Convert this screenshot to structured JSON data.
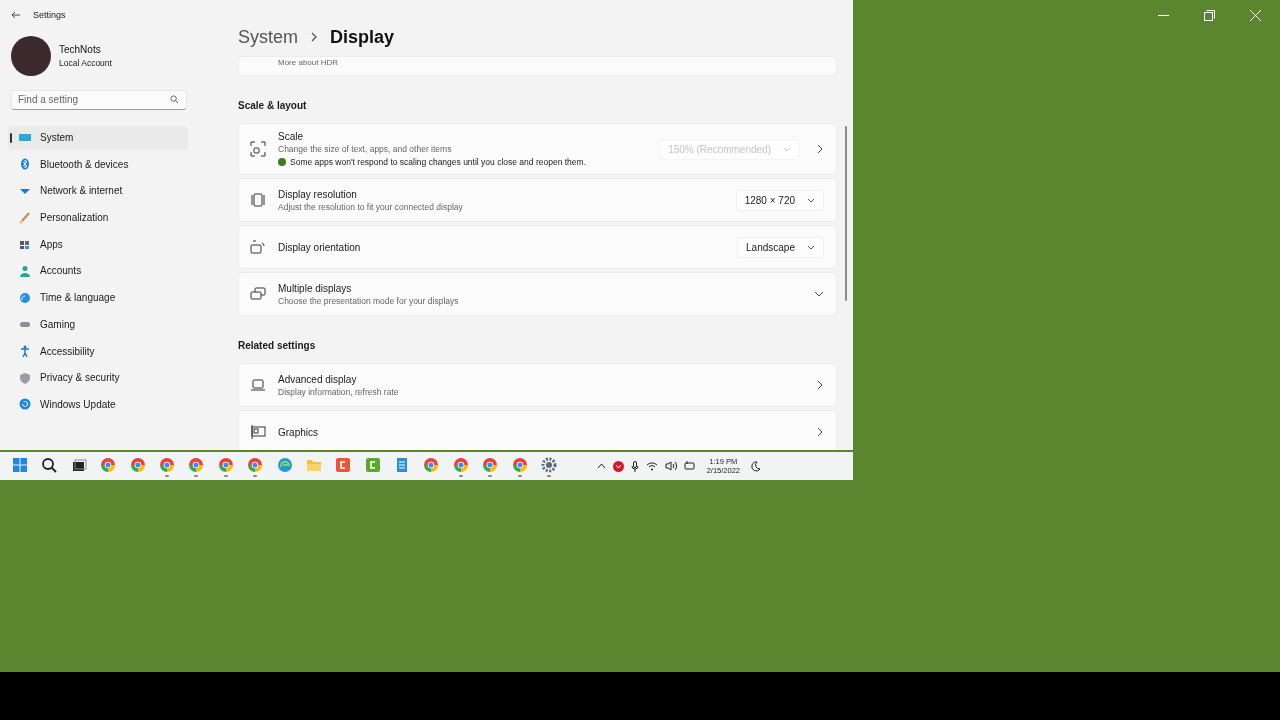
{
  "window": {
    "title": "Settings"
  },
  "account": {
    "name": "TechNots",
    "type": "Local Account"
  },
  "search": {
    "placeholder": "Find a setting"
  },
  "sidebar": {
    "items": [
      {
        "label": "System",
        "selected": true
      },
      {
        "label": "Bluetooth & devices",
        "selected": false
      },
      {
        "label": "Network & internet",
        "selected": false
      },
      {
        "label": "Personalization",
        "selected": false
      },
      {
        "label": "Apps",
        "selected": false
      },
      {
        "label": "Accounts",
        "selected": false
      },
      {
        "label": "Time & language",
        "selected": false
      },
      {
        "label": "Gaming",
        "selected": false
      },
      {
        "label": "Accessibility",
        "selected": false
      },
      {
        "label": "Privacy & security",
        "selected": false
      },
      {
        "label": "Windows Update",
        "selected": false
      }
    ]
  },
  "breadcrumb": {
    "parent": "System",
    "current": "Display"
  },
  "top_card": {
    "label": "More about HDR"
  },
  "sections": [
    {
      "heading": "Scale & layout",
      "rows": [
        {
          "kind": "dropdown-link",
          "title": "Scale",
          "description": "Change the size of text, apps, and other items",
          "note": "Some apps won't respond to scaling changes until you close and reopen them.",
          "value": "150% (Recommended)",
          "disabled": true
        },
        {
          "kind": "dropdown",
          "title": "Display resolution",
          "description": "Adjust the resolution to fit your connected display",
          "value": "1280 × 720",
          "disabled": false
        },
        {
          "kind": "dropdown",
          "title": "Display orientation",
          "value": "Landscape",
          "disabled": false
        },
        {
          "kind": "expander",
          "title": "Multiple displays",
          "description": "Choose the presentation mode for your displays",
          "expanded": false
        }
      ]
    },
    {
      "heading": "Related settings",
      "rows": [
        {
          "kind": "link",
          "title": "Advanced display",
          "description": "Display information, refresh rate"
        },
        {
          "kind": "link",
          "title": "Graphics"
        }
      ]
    }
  ],
  "taskbar": {
    "apps": [
      {
        "kind": "start"
      },
      {
        "kind": "search"
      },
      {
        "kind": "taskview"
      },
      {
        "kind": "chrome",
        "running": false
      },
      {
        "kind": "chrome",
        "running": false
      },
      {
        "kind": "chrome",
        "running": true
      },
      {
        "kind": "chrome",
        "running": true
      },
      {
        "kind": "chrome",
        "running": true
      },
      {
        "kind": "chrome",
        "running": true
      },
      {
        "kind": "edge"
      },
      {
        "kind": "folder"
      },
      {
        "kind": "camtasia-red"
      },
      {
        "kind": "camtasia-green"
      },
      {
        "kind": "notepad"
      },
      {
        "kind": "chrome",
        "running": false
      },
      {
        "kind": "chrome",
        "running": true
      },
      {
        "kind": "chrome",
        "running": true
      },
      {
        "kind": "chrome",
        "running": true
      },
      {
        "kind": "gear",
        "running": true
      }
    ],
    "time": "1:19 PM",
    "date": "2/15/2022"
  }
}
